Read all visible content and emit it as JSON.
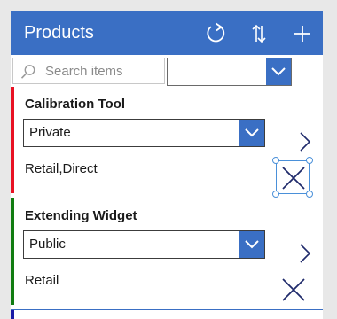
{
  "header": {
    "title": "Products",
    "icons": [
      "refresh-icon",
      "sort-icon",
      "add-icon"
    ]
  },
  "search": {
    "placeholder": "Search items",
    "value": ""
  },
  "filter": {
    "selected": ""
  },
  "products": [
    {
      "name": "Calibration Tool",
      "visibility": "Private",
      "channels": "Retail,Direct",
      "status_color": "#e81123"
    },
    {
      "name": "Extending Widget",
      "visibility": "Public",
      "channels": "Retail",
      "status_color": "#107c10"
    }
  ],
  "next_item_status_color": "#1a1aa6",
  "colors": {
    "accent": "#3a6fc4",
    "icon_dark": "#1f2a6b"
  }
}
